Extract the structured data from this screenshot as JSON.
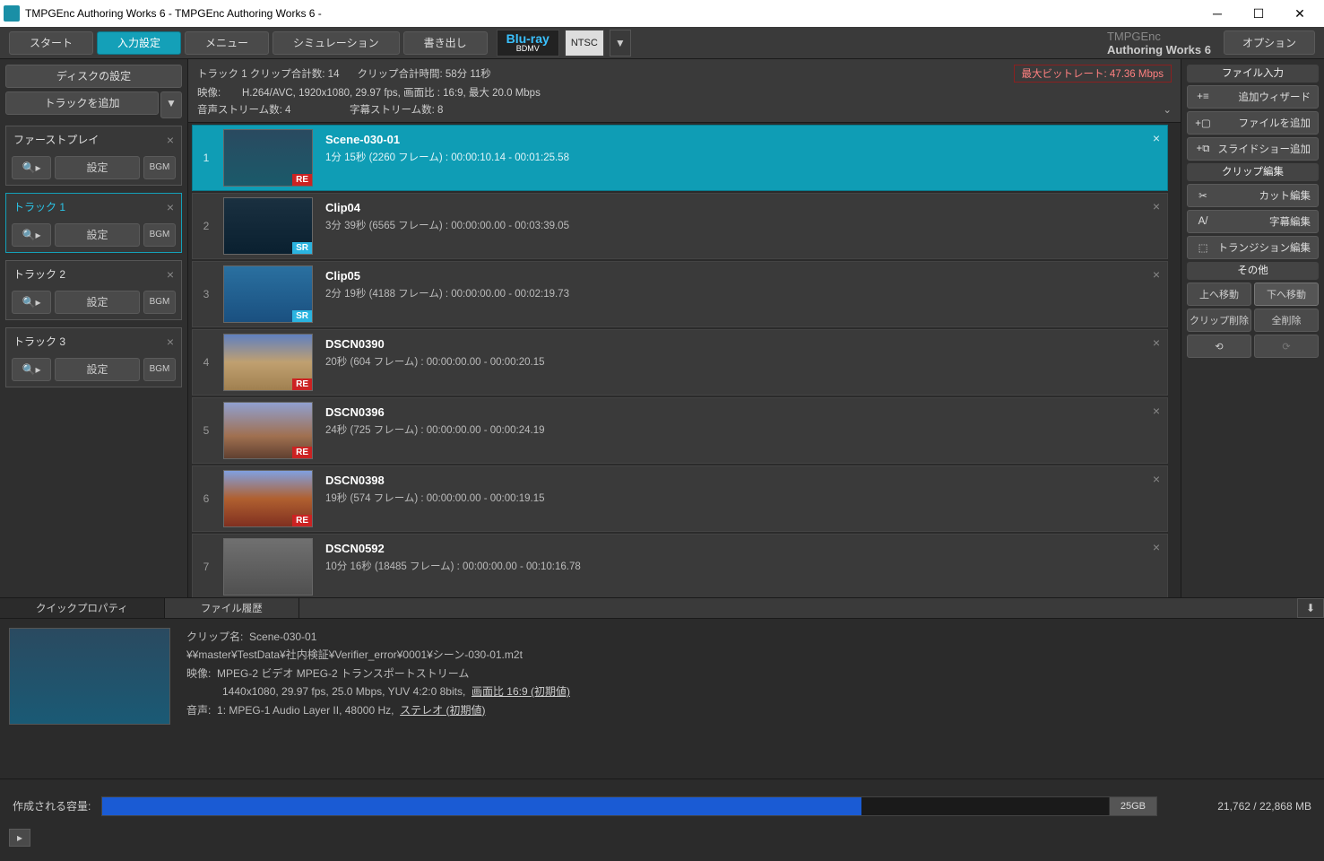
{
  "window": {
    "title": "TMPGEnc Authoring Works 6 - TMPGEnc Authoring Works 6 -"
  },
  "toolbar": {
    "start": "スタート",
    "input": "入力設定",
    "menu": "メニュー",
    "simulation": "シミュレーション",
    "export": "書き出し",
    "format_top": "Blu-ray",
    "format_bot": "BDMV",
    "ntsc": "NTSC",
    "brand_prefix": "TMPGEnc",
    "brand_main": "Authoring Works 6",
    "option": "オプション"
  },
  "left": {
    "disc_settings": "ディスクの設定",
    "add_track": "トラックを追加",
    "firstplay": "ファーストプレイ",
    "settings": "設定",
    "bgm": "BGM",
    "tracks": [
      {
        "name": "トラック 1"
      },
      {
        "name": "トラック 2"
      },
      {
        "name": "トラック 3"
      }
    ]
  },
  "header": {
    "line1_a": "トラック 1  クリップ合計数:  14",
    "line1_b": "クリップ合計時間:  58分 11秒",
    "bitrate": "最大ビットレート: 47.36 Mbps",
    "line2_a": "映像:",
    "line2_b": "H.264/AVC,  1920x1080,  29.97 fps,  画面比 : 16:9, 最大 20.0 Mbps",
    "line3_a": "音声ストリーム数: 4",
    "line3_b": "字幕ストリーム数: 8"
  },
  "clips": [
    {
      "n": "1",
      "name": "Scene-030-01",
      "dur": "1分 15秒 (2260 フレーム) :  00:00:10.14 - 00:01:25.58",
      "badge": "RE",
      "thumb": "water",
      "sel": true
    },
    {
      "n": "2",
      "name": "Clip04",
      "dur": "3分 39秒 (6565 フレーム) :  00:00:00.00 - 00:03:39.05",
      "badge": "SR",
      "thumb": "water2"
    },
    {
      "n": "3",
      "name": "Clip05",
      "dur": "2分 19秒 (4188 フレーム) :  00:00:00.00 - 00:02:19.73",
      "badge": "SR",
      "thumb": "water3"
    },
    {
      "n": "4",
      "name": "DSCN0390",
      "dur": "20秒 (604 フレーム) :  00:00:00.00 - 00:00:20.15",
      "badge": "RE",
      "thumb": "desert"
    },
    {
      "n": "5",
      "name": "DSCN0396",
      "dur": "24秒 (725 フレーム) :  00:00:00.00 - 00:00:24.19",
      "badge": "RE",
      "thumb": "rock"
    },
    {
      "n": "6",
      "name": "DSCN0398",
      "dur": "19秒 (574 フレーム) :  00:00:00.00 - 00:00:19.15",
      "badge": "RE",
      "thumb": "rock2"
    },
    {
      "n": "7",
      "name": "DSCN0592",
      "dur": "10分 16秒 (18485 フレーム) :  00:00:00.00 - 00:10:16.78",
      "badge": "",
      "thumb": "fog"
    }
  ],
  "right": {
    "file_input": "ファイル入力",
    "add_wizard": "追加ウィザード",
    "add_file": "ファイルを追加",
    "add_slideshow": "スライドショー追加",
    "clip_edit": "クリップ編集",
    "cut_edit": "カット編集",
    "subtitle_edit": "字幕編集",
    "transition_edit": "トランジション編集",
    "other": "その他",
    "move_up": "上へ移動",
    "move_down": "下へ移動",
    "delete_clip": "クリップ削除",
    "delete_all": "全削除"
  },
  "tabs": {
    "quick_props": "クイックプロパティ",
    "file_history": "ファイル履歴"
  },
  "props": {
    "clipname_label": "クリップ名:",
    "clipname": "Scene-030-01",
    "path": "¥¥master¥TestData¥社内検証¥Verifier_error¥0001¥シーン-030-01.m2t",
    "video_label": "映像:",
    "video1": "MPEG-2 ビデオ  MPEG-2 トランスポートストリーム",
    "video2": "1440x1080,  29.97 fps,  25.0 Mbps,  YUV 4:2:0 8bits,",
    "video2u": "画面比 16:9 (初期値)",
    "audio_label": "音声:",
    "audio": "1:  MPEG-1 Audio Layer II, 48000 Hz,",
    "audiou": "ステレオ (初期値)"
  },
  "footer": {
    "label": "作成される容量:",
    "cap": "25GB",
    "size": "21,762 / 22,868 MB"
  }
}
